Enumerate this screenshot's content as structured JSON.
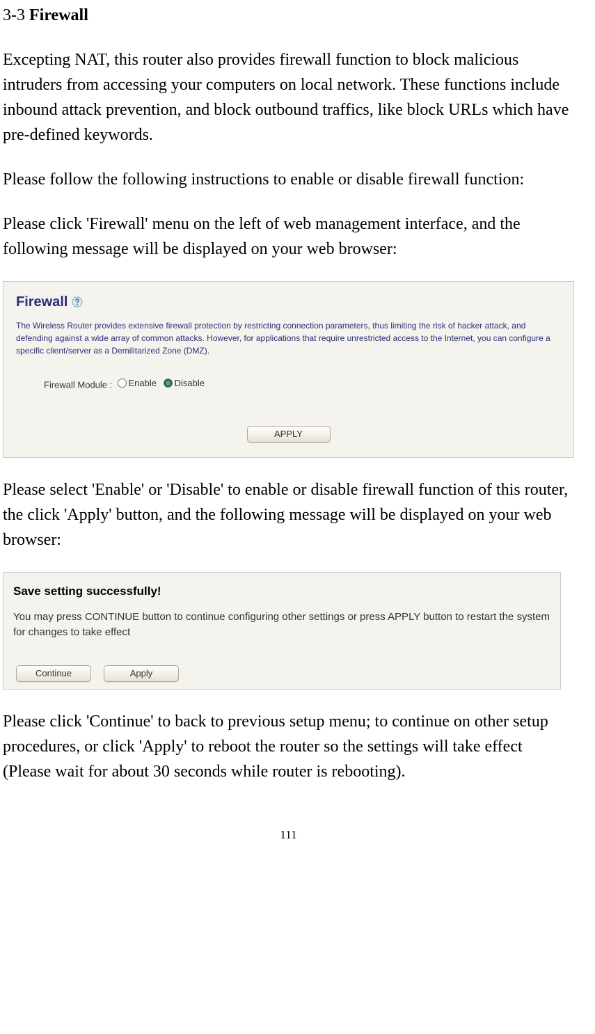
{
  "heading": {
    "num": "3-3 ",
    "title": "Firewall"
  },
  "para1": "Excepting NAT, this router also provides firewall function to block malicious intruders from accessing your computers on local network. These functions include inbound attack prevention, and block outbound traffics, like block URLs which have pre-defined keywords.",
  "para2": "Please follow the following instructions to enable or disable firewall function:",
  "para3": "Please click 'Firewall' menu on the left of web management interface, and the following message will be displayed on your web browser:",
  "panel1": {
    "title": "Firewall",
    "desc": "The Wireless Router provides extensive firewall protection by restricting connection parameters, thus limiting the risk of hacker attack, and defending against a wide array of common attacks. However, for applications that require unrestricted access to the Internet, you can configure a specific client/server as a Demilitarized Zone (DMZ).",
    "module_label": "Firewall Module :",
    "enable": "Enable",
    "disable": "Disable",
    "apply": "APPLY"
  },
  "para4": "Please select 'Enable' or 'Disable' to enable or disable firewall function of this router, the click 'Apply' button, and the following message will be displayed on your web browser:",
  "panel2": {
    "title": "Save setting successfully!",
    "desc": "You may press CONTINUE button to continue configuring other settings or press APPLY button to restart the system for changes to take effect",
    "continue": "Continue",
    "apply": "Apply"
  },
  "para5": "Please click 'Continue' to back to previous setup menu; to continue on other setup procedures, or click 'Apply' to reboot the router so the settings will take effect (Please wait for about 30 seconds while router is rebooting).",
  "page_num": "111"
}
